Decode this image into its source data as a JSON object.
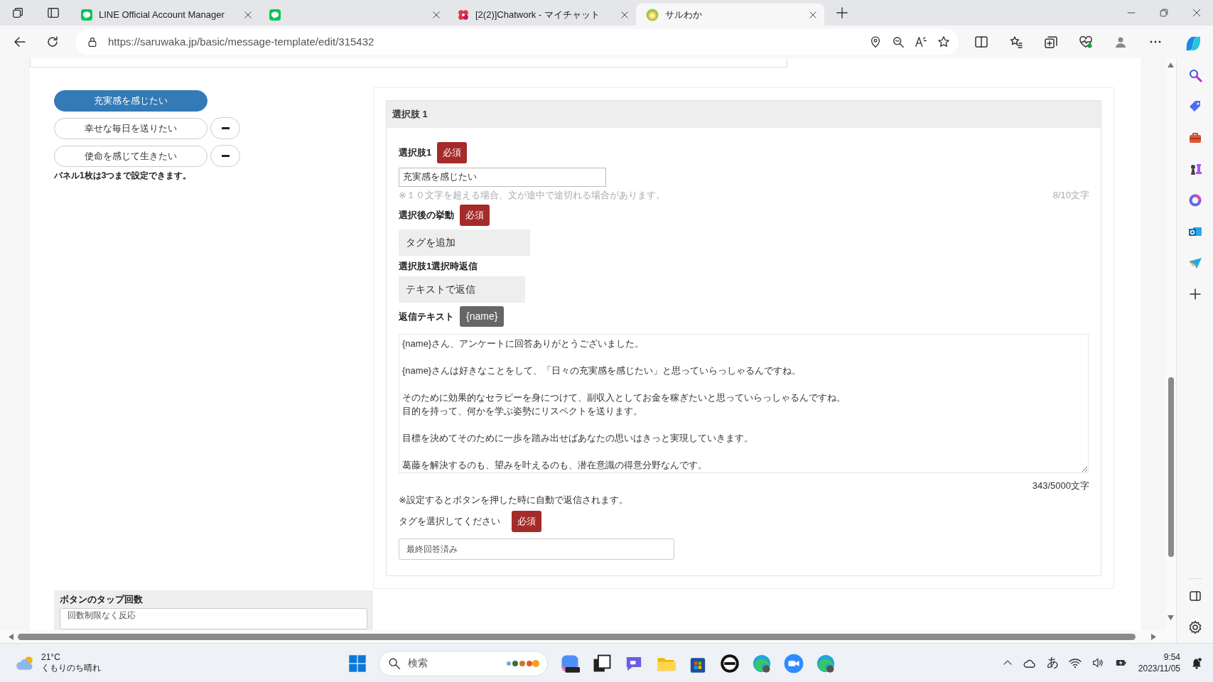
{
  "browser": {
    "tabs": [
      {
        "kind": "line",
        "title": "LINE Official Account Manager",
        "selected": false
      },
      {
        "kind": "line",
        "selected": false
      },
      {
        "kind": "chatwork",
        "title": "[2(2)]Chatwork - マイチャット",
        "selected": false
      },
      {
        "kind": "saruwaka",
        "title": "サルわか",
        "selected": true
      }
    ],
    "url": "https://saruwaka.jp/basic/message-template/edit/315432"
  },
  "choices": [
    {
      "label": "充実感を感じたい",
      "selected": true,
      "removable": false
    },
    {
      "label": "幸せな毎日を送りたい",
      "selected": false,
      "removable": true
    },
    {
      "label": "使命を感じて生きたい",
      "selected": false,
      "removable": true
    }
  ],
  "choices_note": "パネル1枚は3つまで設定できます。",
  "choice_panel": {
    "header": "選択肢 1",
    "text_field": {
      "label": "選択肢1",
      "badge": "必須",
      "value": "充実感を感じたい",
      "hint": "※１０文字を超える場合、文が途中で途切れる場合があります。",
      "count": "8/10文字"
    },
    "action": {
      "label": "選択後の挙動",
      "badge": "必須",
      "value": "タグを追加"
    },
    "reply": {
      "label": "選択肢1選択時返信",
      "value": "テキストで返信"
    },
    "reply_text": {
      "label": "返信テキスト",
      "insert_button": "{name}",
      "paragraphs": [
        [
          "{name}さん、アンケートに回答ありがとうございました。"
        ],
        [
          "{name}さんは好きなことをして、「日々の充実感を感じたい」と思っていらっしゃるんですね。"
        ],
        [
          "そのために効果的なセラピーを身につけて、副収入としてお金を稼ぎたいと思っていらっしゃるんですね。",
          "目的を持って、何かを学ぶ姿勢にリスペクトを送ります。"
        ],
        [
          "目標を決めてそのために一歩を踏み出せばあなたの思いはきっと実現していきます。"
        ],
        [
          "葛藤を解決するのも、望みを叶えるのも、潜在意識の得意分野なんです。"
        ]
      ],
      "count": "343/5000文字",
      "note": "※設定するとボタンを押した時に自動で返信されます。"
    },
    "tag": {
      "label": "タグを選択してください",
      "badge": "必須",
      "value": "最終回答済み"
    }
  },
  "tap_count": {
    "label": "ボタンのタップ回数",
    "value": "回数制限なく反応"
  },
  "taskbar": {
    "temperature": "21°C",
    "weather": "くもりのち晴れ",
    "search_placeholder": "検索",
    "ime": "あ",
    "time": "9:54",
    "date": "2023/11/05"
  }
}
